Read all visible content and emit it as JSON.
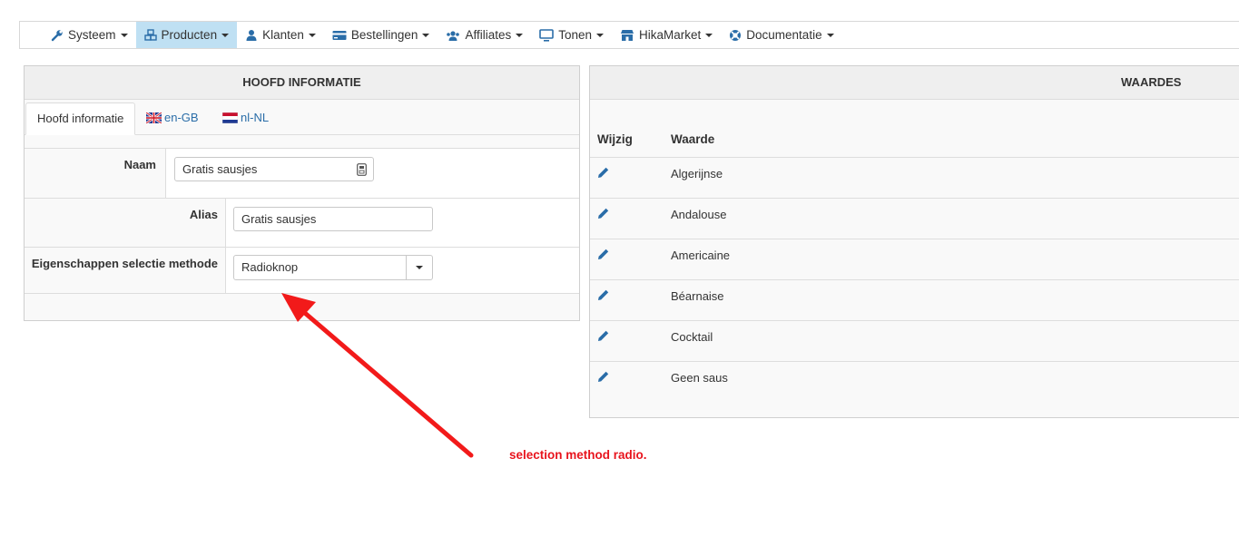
{
  "navbar": {
    "items": [
      {
        "label": "Systeem",
        "icon": "wrench-icon"
      },
      {
        "label": "Producten",
        "icon": "cubes-icon",
        "active": true
      },
      {
        "label": "Klanten",
        "icon": "user-icon"
      },
      {
        "label": "Bestellingen",
        "icon": "credit-card-icon"
      },
      {
        "label": "Affiliates",
        "icon": "users-icon"
      },
      {
        "label": "Tonen",
        "icon": "monitor-icon"
      },
      {
        "label": "HikaMarket",
        "icon": "shop-icon"
      },
      {
        "label": "Documentatie",
        "icon": "lifebuoy-icon"
      }
    ],
    "active_color": "#bfe0f3"
  },
  "left_panel": {
    "title": "HOOFD INFORMATIE",
    "tabs": [
      {
        "label": "Hoofd informatie",
        "active": true
      },
      {
        "label": "en-GB",
        "icon": "uk-flag-icon"
      },
      {
        "label": "nl-NL",
        "icon": "nl-flag-icon"
      }
    ],
    "fields": {
      "naam": {
        "label": "Naam",
        "value": "Gratis sausjes"
      },
      "alias": {
        "label": "Alias",
        "value": "Gratis sausjes"
      },
      "selection_method": {
        "label": "Eigenschappen selectie methode",
        "value": "Radioknop"
      }
    }
  },
  "right_panel": {
    "title": "WAARDES",
    "columns": {
      "edit": "Wijzig",
      "value": "Waarde"
    },
    "rows": [
      "Algerijnse",
      "Andalouse",
      "Americaine",
      "Béarnaise",
      "Cocktail",
      "Geen saus"
    ]
  },
  "annotation": {
    "text": "selection method radio.",
    "color": "#e8141d"
  },
  "colors": {
    "link": "#2a6da8",
    "icon": "#2a6da8"
  }
}
